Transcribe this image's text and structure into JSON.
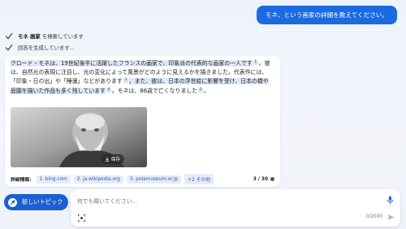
{
  "user_message": "モネ、という画家の詳細を教えてください。",
  "status": [
    {
      "keyword": "モネ 画家",
      "text": " を検索しています"
    },
    {
      "keyword": "",
      "text": "回答を生成しています..."
    }
  ],
  "answer": {
    "line1": "クロード・モネは、19世紀後半に活躍したフランスの画家で、印象派の代表的な画家の一人です",
    "cite1": "1",
    "line2": "。彼は、自然光の表現に注目し、光の変化によって風景がどのように見えるかを描きました。代表作には、「印象・日の出」や「睡蓮」などがあります",
    "cite2": "3",
    "line3": "。また、彼は、日本の浮世絵に影響を受け、日本の橋や庭園を描いた作品も多く残しています",
    "cite3": "4",
    "line4": "。モネは、86歳で亡くなりました",
    "cite4": "2",
    "line5": "。",
    "image_save_label": "保存"
  },
  "references": {
    "label": "詳細情報:",
    "items": [
      "1. bing.com",
      "2. ja.wikipedia.org",
      "3. polamuseum.or.jp",
      "+2 その他"
    ],
    "count": "3 / 30"
  },
  "new_topic_label": "新しいトピック",
  "input": {
    "placeholder": "何でも聞いてください...",
    "counter": "0/2000"
  },
  "colors": {
    "accent": "#1b6ae0",
    "new_topic_bg": "#1b5fd2"
  }
}
